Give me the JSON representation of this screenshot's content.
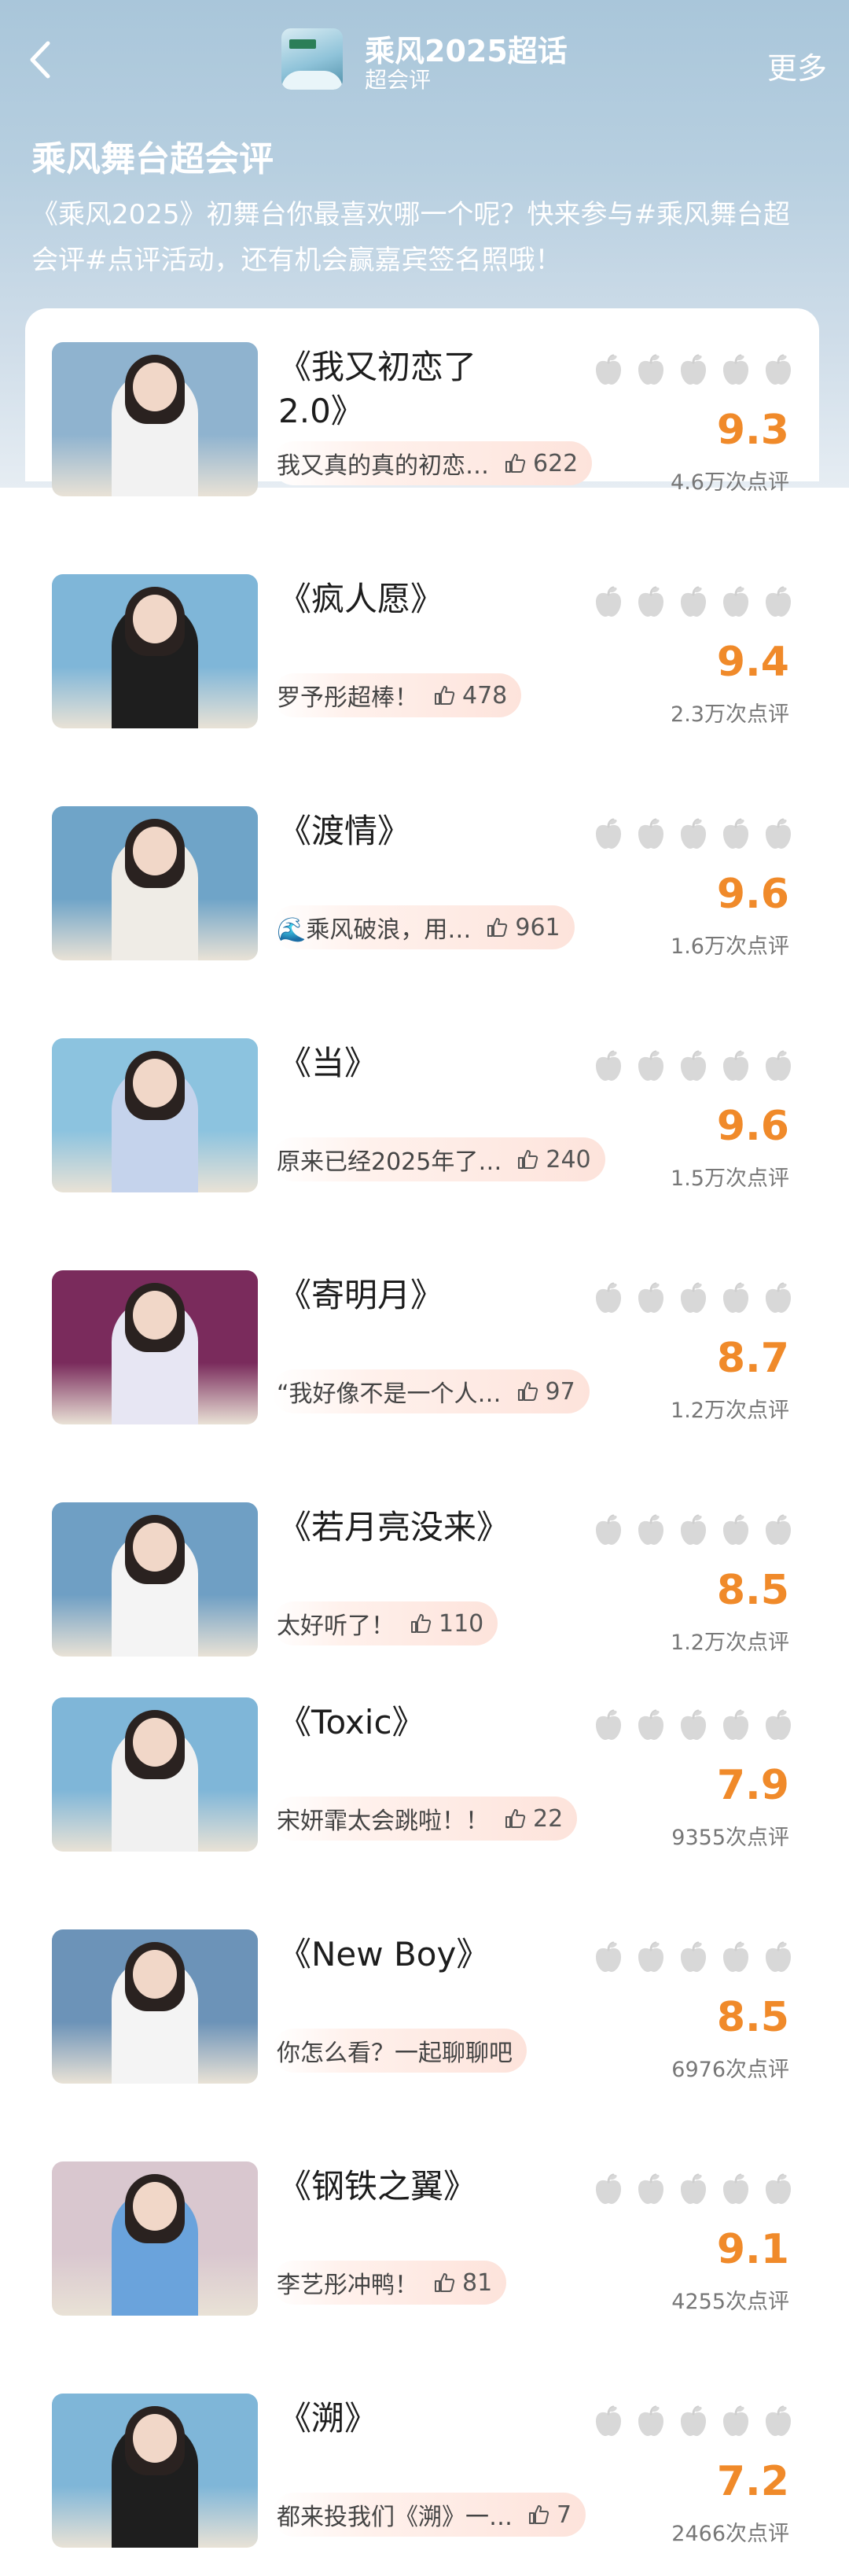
{
  "header": {
    "title": "乘风2025超话",
    "subtitle": "超会评",
    "more_label": "更多"
  },
  "page_heading": "乘风舞台超会评",
  "intro": "《乘风2025》初舞台你最喜欢哪一个呢？快来参与#乘风舞台超会评#点评活动，还有机会赢嘉宾签名照哦！",
  "items": [
    {
      "song": "《我又初恋了2.0》",
      "comment": "我又真的真的初恋…",
      "likes": "622",
      "score": "9.3",
      "reviews": "4.6万次点评",
      "bg": "#8fb3cf",
      "outfit": "#f2f2f2"
    },
    {
      "song": "《疯人愿》",
      "comment": "罗予彤超棒！",
      "likes": "478",
      "score": "9.4",
      "reviews": "2.3万次点评",
      "bg": "#7fb6d8",
      "outfit": "#1e1e1e"
    },
    {
      "song": "《渡情》",
      "comment": "🌊乘风破浪，用…",
      "likes": "961",
      "score": "9.6",
      "reviews": "1.6万次点评",
      "bg": "#6fa4c8",
      "outfit": "#efece6"
    },
    {
      "song": "《当》",
      "comment": "原来已经2025年了…",
      "likes": "240",
      "score": "9.6",
      "reviews": "1.5万次点评",
      "bg": "#8cc3df",
      "outfit": "#c5d3ec"
    },
    {
      "song": "《寄明月》",
      "comment": "“我好像不是一个人…",
      "likes": "97",
      "score": "8.7",
      "reviews": "1.2万次点评",
      "bg": "#7a2b5c",
      "outfit": "#e7e6f3"
    },
    {
      "song": "《若月亮没来》",
      "comment": "太好听了！",
      "likes": "110",
      "score": "8.5",
      "reviews": "1.2万次点评",
      "bg": "#6f9fc4",
      "outfit": "#f4f4f4"
    },
    {
      "song": "《Toxic》",
      "comment": "宋妍霏太会跳啦！！",
      "likes": "22",
      "score": "7.9",
      "reviews": "9355次点评",
      "bg": "#7fb6d8",
      "outfit": "#f1f1f1"
    },
    {
      "song": "《New Boy》",
      "comment": "你怎么看？一起聊聊吧",
      "likes": "",
      "score": "8.5",
      "reviews": "6976次点评",
      "bg": "#6c93b8",
      "outfit": "#f4f4f4"
    },
    {
      "song": "《钢铁之翼》",
      "comment": "李艺彤冲鸭！",
      "likes": "81",
      "score": "9.1",
      "reviews": "4255次点评",
      "bg": "#d9c7cf",
      "outfit": "#6aa3dc"
    },
    {
      "song": "《溯》",
      "comment": "都来投我们《溯》一…",
      "likes": "7",
      "score": "7.2",
      "reviews": "2466次点评",
      "bg": "#7fb6d8",
      "outfit": "#1e1e1e"
    }
  ]
}
